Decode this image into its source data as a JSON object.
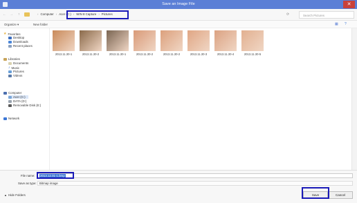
{
  "window": {
    "title": "Save an Image File",
    "close": "✕"
  },
  "nav": {
    "back": "←",
    "forward": "→",
    "up": "↑"
  },
  "breadcrumb": [
    "Computer",
    "Acer (C:)",
    "WIN 8 Capture",
    "Pictures"
  ],
  "search": {
    "placeholder": "Search Pictures"
  },
  "toolbar": {
    "organize": "Organize ▾",
    "new_folder": "New folder"
  },
  "sidebar": {
    "favorites": "Favorites",
    "fav_items": [
      "Desktop",
      "Downloads",
      "Recent places"
    ],
    "libraries": "Libraries",
    "lib_items": [
      "Documents",
      "Music",
      "Pictures",
      "Videos"
    ],
    "computer": "Computer",
    "comp_items": [
      "Acer (C:)",
      "DATA (D:)",
      "Removable Disk (E:)"
    ],
    "network": "Network"
  },
  "files": [
    {
      "name": "2013.11.30-1",
      "color": "#c98a5a"
    },
    {
      "name": "2013.11.30-2",
      "color": "#8a6a4a"
    },
    {
      "name": "2013.11.30-1",
      "color": "#7a6552"
    },
    {
      "name": "2013.11.30-2",
      "color": "#d99a78"
    },
    {
      "name": "2013.11.30-2",
      "color": "#dca07c"
    },
    {
      "name": "2013.11.30-3",
      "color": "#e0a684"
    },
    {
      "name": "2013.11.30-4",
      "color": "#dba282"
    },
    {
      "name": "2013.11.30-5",
      "color": "#e2b090"
    }
  ],
  "form": {
    "filename_label": "File name:",
    "filename_value": "2013.12.01-1.bmp",
    "type_label": "Save as type:",
    "type_value": "Bitmap image"
  },
  "footer": {
    "hide_folders": "Hide Folders",
    "save": "Save",
    "cancel": "Cancel"
  },
  "colors": {
    "titlebar": "#5b7fd6",
    "annotation": "#1a1ab8",
    "close": "#c9413a"
  }
}
